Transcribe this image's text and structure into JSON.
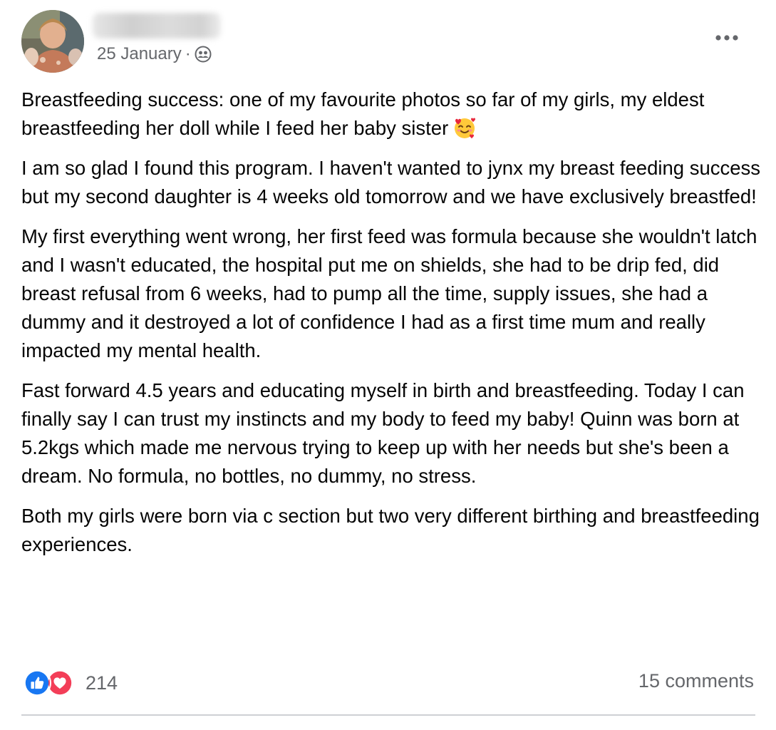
{
  "post": {
    "date": "25 January",
    "separator": "·",
    "audience_icon": "friends-icon",
    "menu_icon": "more-horizontal-icon",
    "paragraphs": [
      "Breastfeeding success: one of my favourite photos so far of my girls, my eldest breastfeeding her doll while I feed her baby sister",
      "I am so glad I found this program. I haven't wanted to jynx my breast feeding success but my second daughter is 4 weeks old tomorrow and we have exclusively breastfed!",
      "My first everything went wrong, her first feed was formula because she wouldn't latch and I wasn't educated, the hospital put me on shields, she had to be drip fed, did breast refusal from 6 weeks, had to pump all the time, supply issues, she had a dummy and it destroyed a lot of confidence I had as a first time mum and really impacted my mental health.",
      "Fast forward 4.5 years and educating myself in birth and breastfeeding. Today I can finally say I can trust my instincts and my body to feed my baby! Quinn was born at 5.2kgs which made me nervous trying to keep up with her needs but she's been a dream. No formula, no bottles, no dummy, no stress.",
      "Both my girls were born via c section but two very different birthing and breastfeeding experiences."
    ],
    "emoji_icon": "smiling-face-with-hearts-icon"
  },
  "footer": {
    "reaction_count": "214",
    "reaction_icons": [
      "like-icon",
      "love-icon"
    ],
    "comments": "15 comments"
  },
  "colors": {
    "text": "#050505",
    "secondary_text": "#65676b",
    "like_blue": "#1877f2",
    "love_red": "#f33e58",
    "divider": "#ced0d4"
  }
}
